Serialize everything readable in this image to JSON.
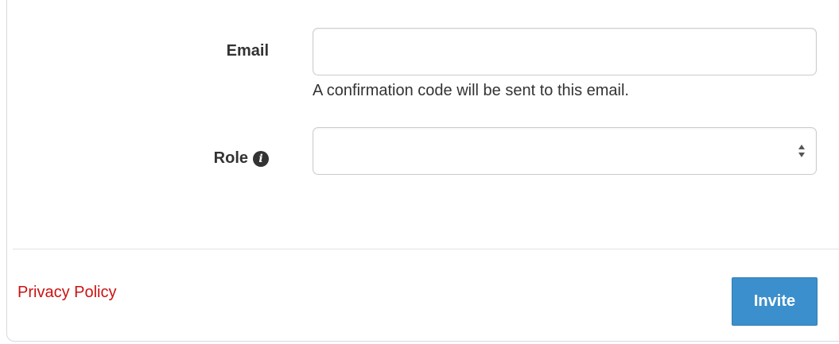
{
  "form": {
    "email_label": "Email",
    "email_value": "",
    "email_help": "A confirmation code will be sent to this email.",
    "role_label": "Role",
    "role_info_icon": "info-circle-icon",
    "role_value": ""
  },
  "footer": {
    "privacy_link": "Privacy Policy",
    "invite_button": "Invite"
  },
  "colors": {
    "link": "#cc1111",
    "primary_button": "#3b8fcc",
    "text": "#333333",
    "border": "#cccccc"
  }
}
